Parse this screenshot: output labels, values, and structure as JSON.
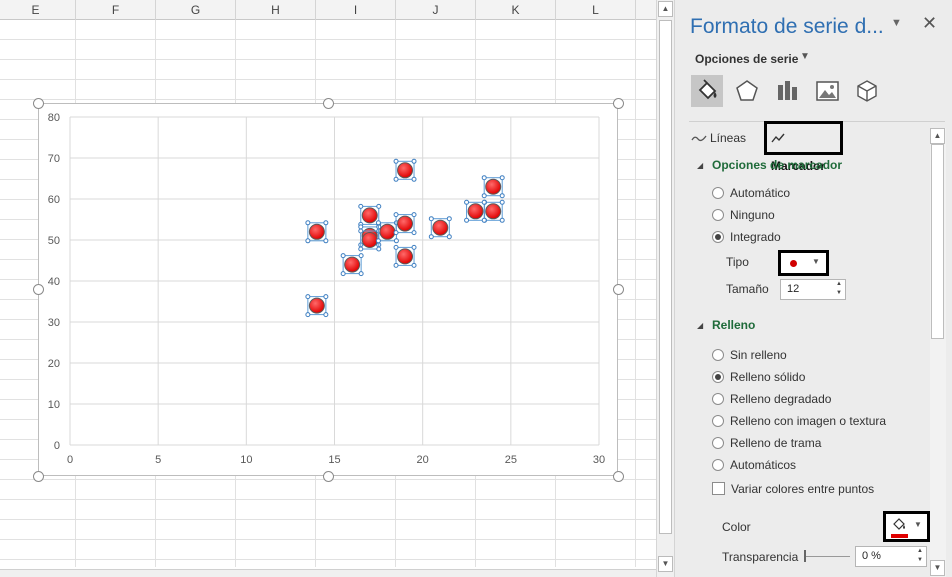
{
  "spreadsheet": {
    "columns": [
      "E",
      "F",
      "G",
      "H",
      "I",
      "J",
      "K",
      "L"
    ]
  },
  "chart_data": {
    "type": "scatter",
    "title": "",
    "xlabel": "",
    "ylabel": "",
    "xlim": [
      0,
      30
    ],
    "ylim": [
      0,
      80
    ],
    "x_ticks": [
      0,
      5,
      10,
      15,
      20,
      25,
      30
    ],
    "y_ticks": [
      0,
      10,
      20,
      30,
      40,
      50,
      60,
      70,
      80
    ],
    "grid": true,
    "marker_color": "#e00000",
    "series": [
      {
        "points": [
          [
            14,
            52
          ],
          [
            14,
            34
          ],
          [
            16,
            44
          ],
          [
            17,
            56
          ],
          [
            17,
            51
          ],
          [
            17,
            50
          ],
          [
            18,
            52
          ],
          [
            19,
            67
          ],
          [
            19,
            54
          ],
          [
            19,
            46
          ],
          [
            21,
            53
          ],
          [
            23,
            57
          ],
          [
            24,
            57
          ],
          [
            24,
            63
          ]
        ]
      }
    ]
  },
  "pane": {
    "title": "Formato de serie d...",
    "menu_icon": "chevron-down-icon",
    "close_icon": "close-icon",
    "series_options_label": "Opciones de serie",
    "tab_lines_label": "Líneas",
    "tab_marker_label": "Marcador",
    "marker_options": {
      "heading": "Opciones de marcador",
      "radios": [
        {
          "label": "Automático",
          "selected": false
        },
        {
          "label": "Ninguno",
          "selected": false
        },
        {
          "label": "Integrado",
          "selected": true
        }
      ],
      "type_label": "Tipo",
      "size_label": "Tamaño",
      "size_value": "12"
    },
    "fill": {
      "heading": "Relleno",
      "radios": [
        {
          "label": "Sin relleno",
          "selected": false
        },
        {
          "label": "Relleno sólido",
          "selected": true
        },
        {
          "label": "Relleno degradado",
          "selected": false
        },
        {
          "label": "Relleno con imagen o textura",
          "selected": false
        },
        {
          "label": "Relleno de trama",
          "selected": false
        },
        {
          "label": "Automáticos",
          "selected": false
        }
      ],
      "vary_colors_label": "Variar colores entre puntos",
      "color_label": "Color",
      "transparency_label": "Transparencia",
      "transparency_value": "0 %"
    },
    "accent_color": "#2f6fb2",
    "section_color": "#1f6b3a"
  }
}
